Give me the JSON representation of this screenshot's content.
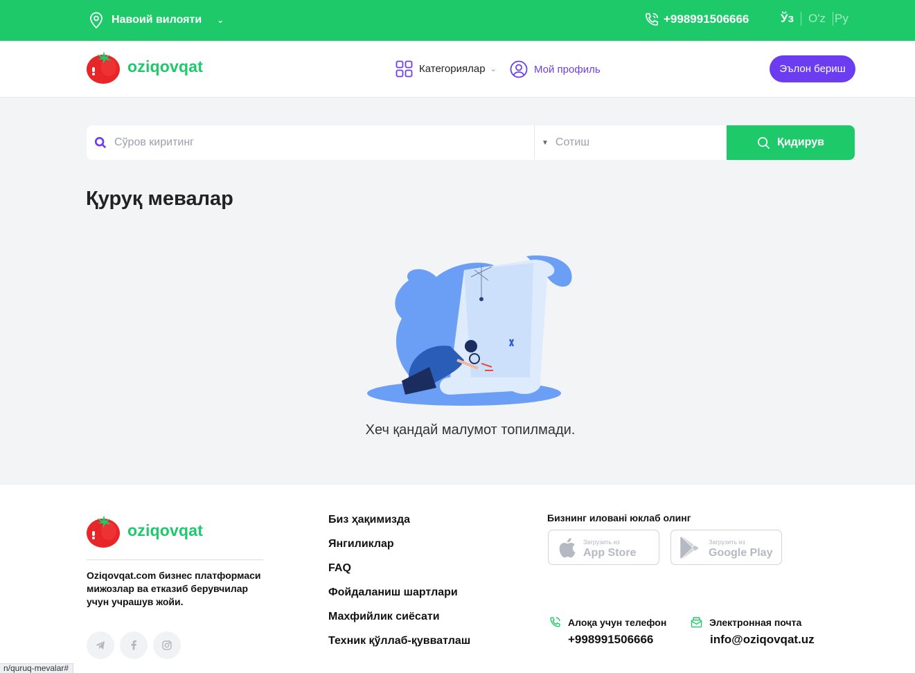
{
  "topbar": {
    "region": "Навоий вилояти",
    "phone": "+998991506666",
    "languages": [
      "Ўз",
      "O'z",
      "Ру"
    ]
  },
  "header": {
    "logo_text": "oziqovqat",
    "categories_label": "Категориялар",
    "profile_label": "Мой профиль",
    "post_ad_label": "Эълон бериш"
  },
  "search": {
    "placeholder": "Сўров киритинг",
    "sort_placeholder": "Сотиш",
    "button_label": "Қидирув"
  },
  "page": {
    "title": "Қуруқ мевалар",
    "empty_message": "Хеч қандай малумот топилмади."
  },
  "footer": {
    "logo_text": "oziqovqat",
    "about": "Oziqovqat.com бизнес платформаси мижозлар ва етказиб берувчилар учун учрашув жойи.",
    "links": [
      "Биз ҳақимизда",
      "Янгиликлар",
      "FAQ",
      "Фойдаланиш шартлари",
      "Махфийлик сиёсати",
      "Техник қўллаб-қувватлаш"
    ],
    "apps_title": "Бизнинг илованi юклаб олинг",
    "app_store": {
      "small": "Загрузить из",
      "big": "App Store"
    },
    "google_play": {
      "small": "Загрузить из",
      "big": "Google Play"
    },
    "phone_label": "Алоқа учун телефон",
    "phone_value": "+998991506666",
    "email_label": "Электронная почта",
    "email_value": "info@oziqovqat.uz"
  },
  "status_url": "n/quruq-mevalar#",
  "colors": {
    "brand_green": "#1ec96a",
    "accent_purple": "#6b3cf0"
  }
}
